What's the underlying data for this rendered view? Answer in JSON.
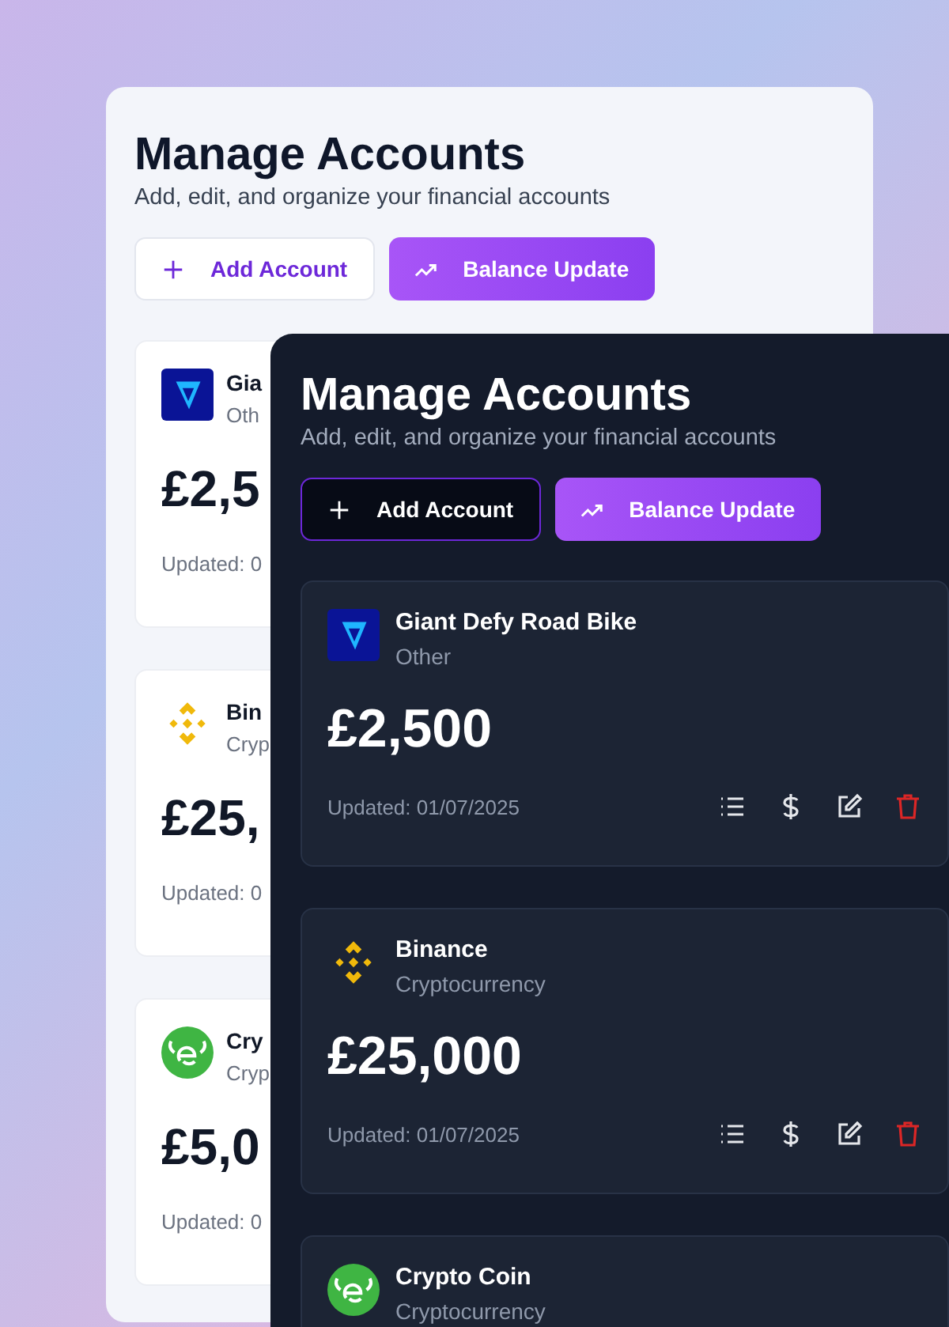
{
  "panels": [
    {
      "title": "Manage Accounts",
      "subtitle": "Add, edit, and organize your financial accounts",
      "buttons": [
        {
          "kind": "outline",
          "label": "Add Account"
        },
        {
          "kind": "primary",
          "label": "Balance Update"
        }
      ],
      "accounts": [
        {
          "name": "Gia",
          "type": "Oth",
          "balance": "£2,5",
          "updated": "Updated: 0"
        },
        {
          "name": "Bin",
          "type": "Cryp",
          "balance": "£25,",
          "updated": "Updated: 0"
        },
        {
          "name": "Cry",
          "type": "Cryp",
          "balance": "£5,0",
          "updated": "Updated: 0"
        }
      ]
    },
    {
      "title": "Manage Accounts",
      "subtitle": "Add, edit, and organize your financial accounts",
      "buttons": [
        {
          "kind": "outline",
          "label": "Add Account"
        },
        {
          "kind": "primary",
          "label": "Balance Update"
        }
      ],
      "accounts": [
        {
          "name": "Giant Defy Road Bike",
          "type": "Other",
          "balance": "£2,500",
          "updated": "Updated: 01/07/2025"
        },
        {
          "name": "Binance",
          "type": "Cryptocurrency",
          "balance": "£25,000",
          "updated": "Updated: 01/07/2025"
        },
        {
          "name": "Crypto Coin",
          "type": "Cryptocurrency"
        }
      ]
    }
  ]
}
